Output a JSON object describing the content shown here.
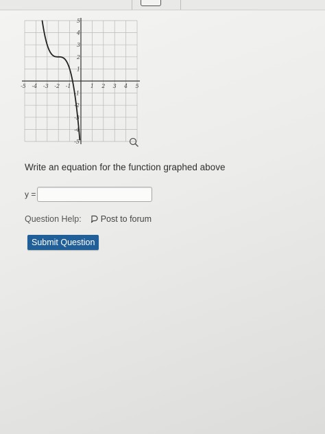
{
  "graph": {
    "x_ticks": [
      "-5",
      "-4",
      "-3",
      "-2",
      "-1",
      "1",
      "2",
      "3",
      "4",
      "5"
    ],
    "y_ticks": [
      "5",
      "4",
      "3",
      "2",
      "1",
      "-1",
      "-2",
      "-3",
      "-4",
      "-5"
    ],
    "xlim": [
      -5,
      5
    ],
    "ylim": [
      -5,
      5
    ],
    "grid": true,
    "curve_color": "#222222",
    "grid_color": "#b9b9b9",
    "axis_color": "#333333",
    "zoom_icon": "magnifier-icon"
  },
  "question": {
    "prompt": "Write an equation for the function graphed above",
    "answer_label": "y =",
    "answer_value": ""
  },
  "help": {
    "label": "Question Help:",
    "forum_link": "Post to forum",
    "forum_icon": "speech-bubble-icon"
  },
  "submit": {
    "label": "Submit Question",
    "color": "#215f99"
  }
}
